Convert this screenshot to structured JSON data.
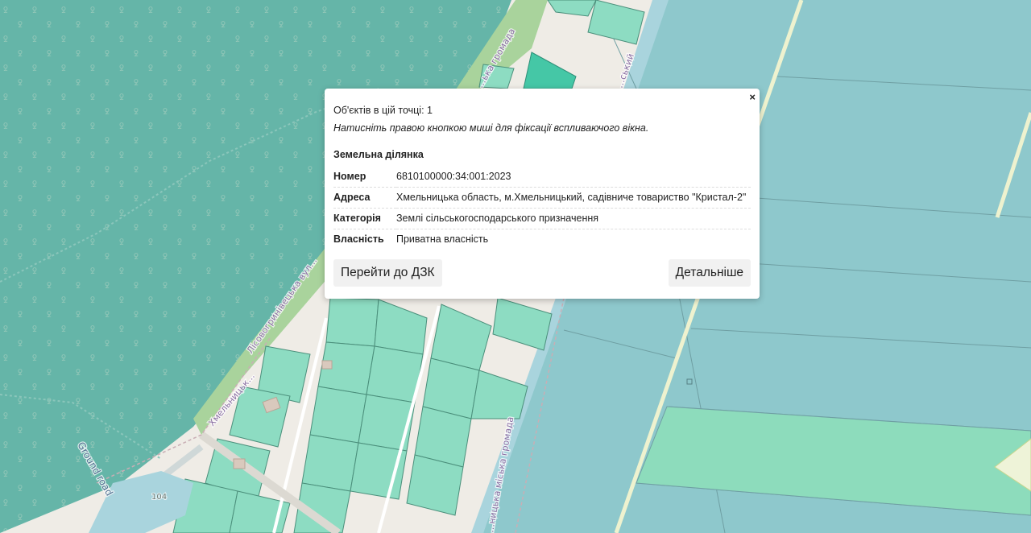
{
  "map": {
    "labels": {
      "hromada_top_left": "…ька громада",
      "hromada_top_right": "…ський",
      "hromada_bottom": "…ницька міська громада",
      "street_lisovogrynivetska": "Лісовогринівецька вул…",
      "street_khmelnytska": "Хмельницьк…",
      "ground_road": "Ground road",
      "house_number": "104"
    }
  },
  "popup": {
    "close_label": "×",
    "objects_count_text": "Об'єктів в цій точці: 1",
    "hint_text": "Натисніть правою кнопкою миші для фіксації вспливаючого вікна.",
    "parcel_title": "Земельна ділянка",
    "attributes": [
      {
        "key": "Номер",
        "value": "6810100000:34:001:2023"
      },
      {
        "key": "Адреса",
        "value": "Хмельницька область, м.Хмельницький, садівниче товариство \"Кристал-2\""
      },
      {
        "key": "Категорія",
        "value": "Землі сільськогосподарського призначення"
      },
      {
        "key": "Власність",
        "value": "Приватна власність"
      }
    ],
    "goto_dzk_label": "Перейти до ДЗК",
    "details_label": "Детальніше"
  }
}
